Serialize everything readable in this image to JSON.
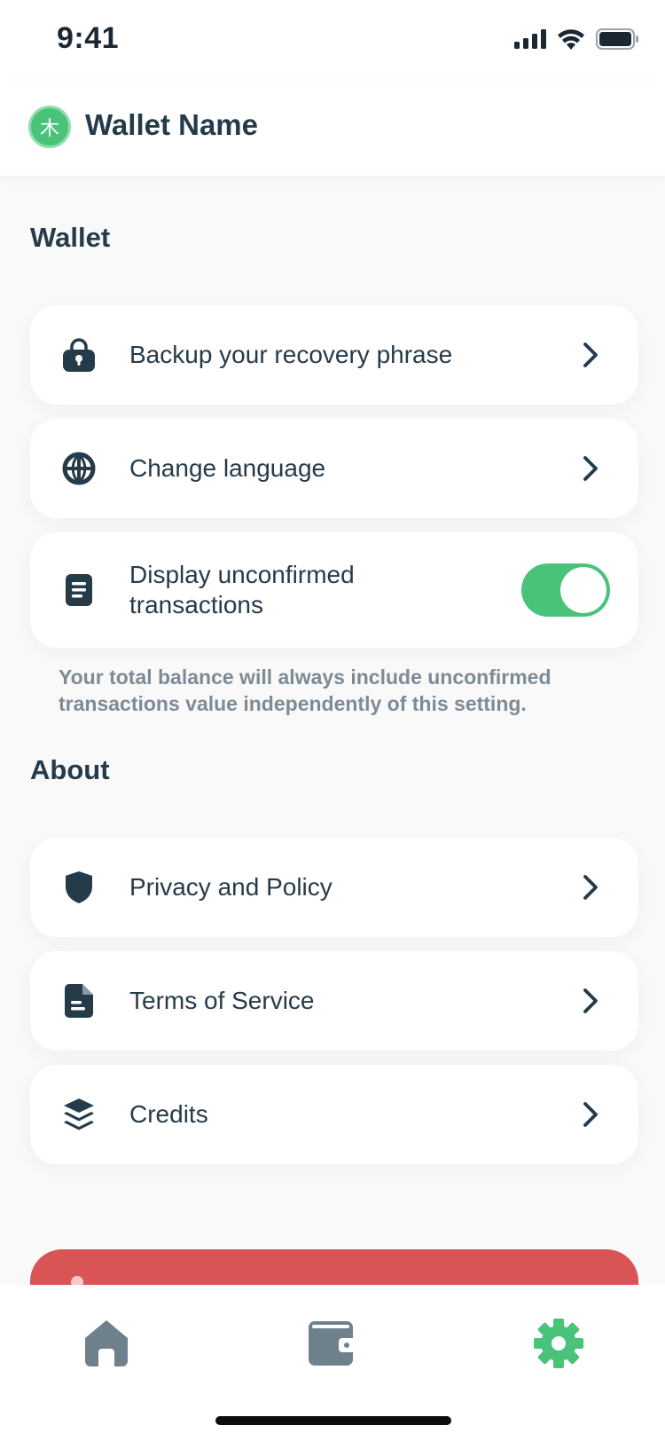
{
  "status_bar": {
    "time": "9:41",
    "icons": [
      "cellular-signal-icon",
      "wifi-icon",
      "battery-icon"
    ]
  },
  "header": {
    "avatar_glyph": "木",
    "wallet_name": "Wallet Name"
  },
  "wallet_section": {
    "title": "Wallet",
    "items": [
      {
        "label": "Backup your recovery phrase",
        "icon": "lock-icon",
        "action": "chevron"
      },
      {
        "label": "Change language",
        "icon": "globe-icon",
        "action": "chevron"
      },
      {
        "label": "Display unconfirmed transactions",
        "icon": "document-icon",
        "action": "toggle",
        "toggle_on": true
      }
    ],
    "hint": "Your total balance will always include unconfirmed transactions value independently of this setting."
  },
  "about_section": {
    "title": "About",
    "items": [
      {
        "label": "Privacy and Policy",
        "icon": "shield-icon",
        "action": "chevron"
      },
      {
        "label": "Terms of Service",
        "icon": "file-icon",
        "action": "chevron"
      },
      {
        "label": "Credits",
        "icon": "layers-icon",
        "action": "chevron"
      }
    ]
  },
  "tab_bar": {
    "tabs": [
      {
        "name": "home",
        "icon": "home-icon",
        "active": false
      },
      {
        "name": "wallet",
        "icon": "wallet-icon",
        "active": false
      },
      {
        "name": "settings",
        "icon": "gear-icon",
        "active": true
      }
    ]
  },
  "colors": {
    "accent": "#49c27a",
    "text": "#263b4a",
    "muted": "#7d8b96",
    "danger": "#d95555",
    "inactive_tab": "#6e818c",
    "background": "#f9f9fa"
  }
}
